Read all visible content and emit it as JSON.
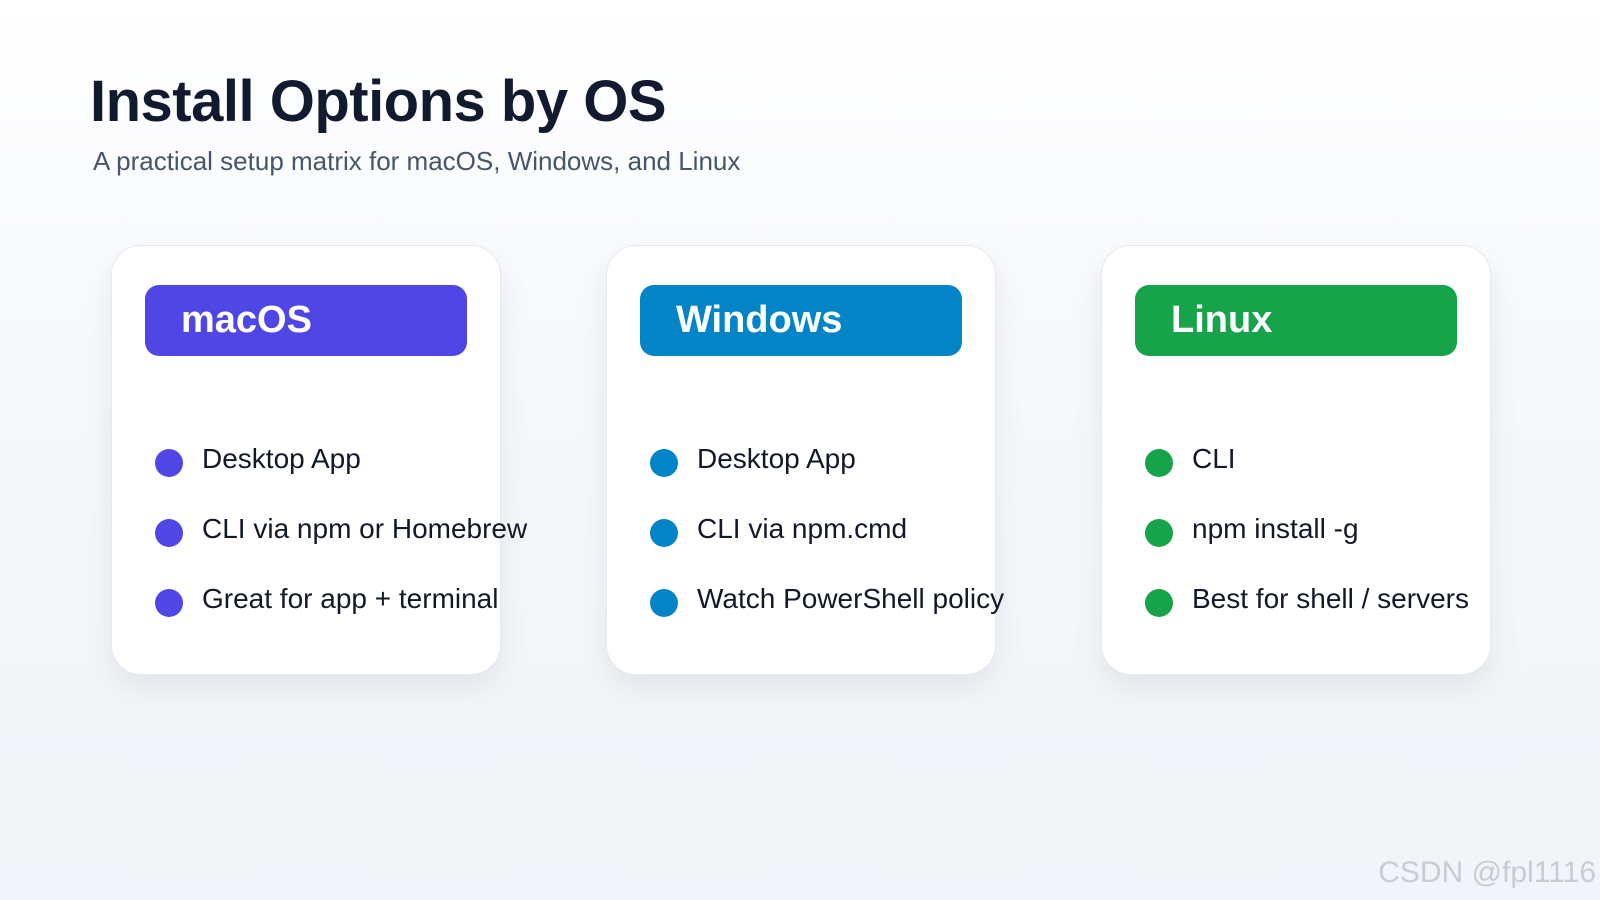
{
  "header": {
    "title": "Install Options by OS",
    "subtitle": "A practical setup matrix for macOS, Windows, and Linux"
  },
  "cards": [
    {
      "label": "macOS",
      "color": "#4f46e5",
      "items": [
        "Desktop App",
        "CLI via npm or Homebrew",
        "Great for app + terminal"
      ]
    },
    {
      "label": "Windows",
      "color": "#0284c7",
      "items": [
        "Desktop App",
        "CLI via npm.cmd",
        "Watch PowerShell policy"
      ]
    },
    {
      "label": "Linux",
      "color": "#16a34a",
      "items": [
        "CLI",
        "npm install -g",
        "Best for shell / servers"
      ]
    }
  ],
  "watermark": "CSDN @fpl1116"
}
